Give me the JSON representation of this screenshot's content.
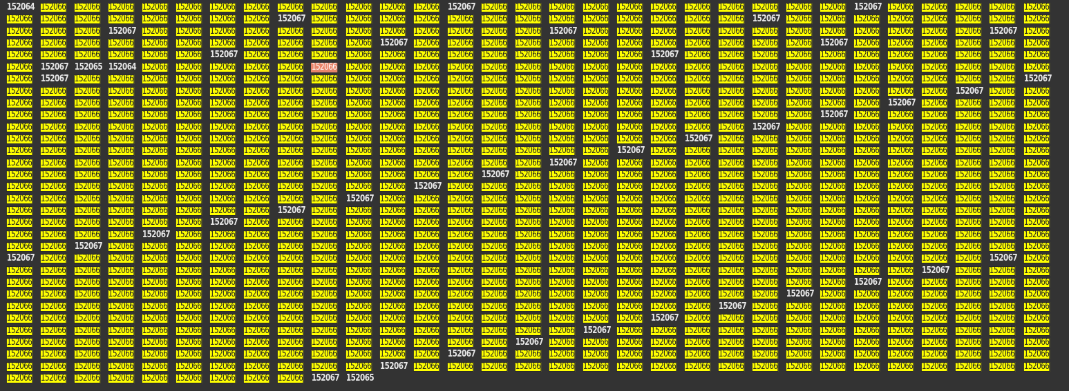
{
  "matches": {
    "match_value": "152066",
    "cursor_value": "152066",
    "colors": {
      "background": "#333333",
      "highlight": "#ffff00",
      "highlight_text": "#222222",
      "plain_text": "#e8e8e8",
      "current_match": "#e8856a"
    },
    "rows": [
      [
        "152064",
        "152066",
        "152066",
        "152066",
        "152066",
        "152066",
        "152066",
        "152066",
        "152066",
        "152066",
        "152066",
        "152066",
        "152066",
        "152067",
        "152066",
        "152066",
        "152066",
        "152066",
        "152066",
        "152066",
        "152066",
        "152066",
        "152066",
        "152066",
        "152066",
        "152067",
        "152066",
        "152066",
        "152066",
        "152066",
        "152066"
      ],
      [
        "152066",
        "152066",
        "152066",
        "152066",
        "152066",
        "152066",
        "152066",
        "152066",
        "152067",
        "152066",
        "152066",
        "152066",
        "152066",
        "152066",
        "152066",
        "152066",
        "152066",
        "152066",
        "152066",
        "152066",
        "152066",
        "152066",
        "152067",
        "152066",
        "152066",
        "152066",
        "152066",
        "152066",
        "152066",
        "152066",
        "152066"
      ],
      [
        "152066",
        "152066",
        "152066",
        "152067",
        "152066",
        "152066",
        "152066",
        "152066",
        "152066",
        "152066",
        "152066",
        "152066",
        "152066",
        "152066",
        "152066",
        "152066",
        "152067",
        "152066",
        "152066",
        "152066",
        "152066",
        "152066",
        "152066",
        "152066",
        "152066",
        "152066",
        "152066",
        "152066",
        "152066",
        "152067",
        "152066"
      ],
      [
        "152066",
        "152066",
        "152066",
        "152066",
        "152066",
        "152066",
        "152066",
        "152066",
        "152066",
        "152066",
        "152066",
        "152067",
        "152066",
        "152066",
        "152066",
        "152066",
        "152066",
        "152066",
        "152066",
        "152066",
        "152066",
        "152066",
        "152066",
        "152066",
        "152067",
        "152066",
        "152066",
        "152066",
        "152066",
        "152066",
        "152066"
      ],
      [
        "152066",
        "152066",
        "152066",
        "152066",
        "152066",
        "152066",
        "152067",
        "152066",
        "152066",
        "152066",
        "152066",
        "152066",
        "152066",
        "152066",
        "152066",
        "152066",
        "152066",
        "152066",
        "152066",
        "152067",
        "152066",
        "152066",
        "152066",
        "152066",
        "152066",
        "152066",
        "152066",
        "152066",
        "152066",
        "152066",
        "152066"
      ],
      [
        "152066",
        "152067",
        "152065",
        "152064",
        "152066",
        "152066",
        "152066",
        "152066",
        "152066",
        "152066",
        "152066",
        "152066",
        "152066",
        "152066",
        "152066",
        "152066",
        "152066",
        "152066",
        "152066",
        "152066",
        "152066",
        "152066",
        "152066",
        "152066",
        "152066",
        "152066",
        "152066",
        "152066",
        "152066",
        "152066",
        "152066"
      ],
      [
        "152066",
        "152067",
        "152066",
        "152066",
        "152066",
        "152066",
        "152066",
        "152066",
        "152066",
        "152066",
        "152066",
        "152066",
        "152066",
        "152066",
        "152066",
        "152066",
        "152066",
        "152066",
        "152066",
        "152066",
        "152066",
        "152066",
        "152066",
        "152066",
        "152066",
        "152066",
        "152066",
        "152066",
        "152066",
        "152066",
        "152067"
      ],
      [
        "152066",
        "152066",
        "152066",
        "152066",
        "152066",
        "152066",
        "152066",
        "152066",
        "152066",
        "152066",
        "152066",
        "152066",
        "152066",
        "152066",
        "152066",
        "152066",
        "152066",
        "152066",
        "152066",
        "152066",
        "152066",
        "152066",
        "152066",
        "152066",
        "152066",
        "152066",
        "152066",
        "152066",
        "152067",
        "152066",
        "152066"
      ],
      [
        "152066",
        "152066",
        "152066",
        "152066",
        "152066",
        "152066",
        "152066",
        "152066",
        "152066",
        "152066",
        "152066",
        "152066",
        "152066",
        "152066",
        "152066",
        "152066",
        "152066",
        "152066",
        "152066",
        "152066",
        "152066",
        "152066",
        "152066",
        "152066",
        "152066",
        "152066",
        "152067",
        "152066",
        "152066",
        "152066",
        "152066"
      ],
      [
        "152066",
        "152066",
        "152066",
        "152066",
        "152066",
        "152066",
        "152066",
        "152066",
        "152066",
        "152066",
        "152066",
        "152066",
        "152066",
        "152066",
        "152066",
        "152066",
        "152066",
        "152066",
        "152066",
        "152066",
        "152066",
        "152066",
        "152066",
        "152066",
        "152067",
        "152066",
        "152066",
        "152066",
        "152066",
        "152066",
        "152066"
      ],
      [
        "152066",
        "152066",
        "152066",
        "152066",
        "152066",
        "152066",
        "152066",
        "152066",
        "152066",
        "152066",
        "152066",
        "152066",
        "152066",
        "152066",
        "152066",
        "152066",
        "152066",
        "152066",
        "152066",
        "152066",
        "152066",
        "152066",
        "152067",
        "152066",
        "152066",
        "152066",
        "152066",
        "152066",
        "152066",
        "152066",
        "152066"
      ],
      [
        "152066",
        "152066",
        "152066",
        "152066",
        "152066",
        "152066",
        "152066",
        "152066",
        "152066",
        "152066",
        "152066",
        "152066",
        "152066",
        "152066",
        "152066",
        "152066",
        "152066",
        "152066",
        "152066",
        "152066",
        "152067",
        "152066",
        "152066",
        "152066",
        "152066",
        "152066",
        "152066",
        "152066",
        "152066",
        "152066",
        "152066"
      ],
      [
        "152066",
        "152066",
        "152066",
        "152066",
        "152066",
        "152066",
        "152066",
        "152066",
        "152066",
        "152066",
        "152066",
        "152066",
        "152066",
        "152066",
        "152066",
        "152066",
        "152066",
        "152066",
        "152067",
        "152066",
        "152066",
        "152066",
        "152066",
        "152066",
        "152066",
        "152066",
        "152066",
        "152066",
        "152066",
        "152066",
        "152066"
      ],
      [
        "152066",
        "152066",
        "152066",
        "152066",
        "152066",
        "152066",
        "152066",
        "152066",
        "152066",
        "152066",
        "152066",
        "152066",
        "152066",
        "152066",
        "152066",
        "152066",
        "152067",
        "152066",
        "152066",
        "152066",
        "152066",
        "152066",
        "152066",
        "152066",
        "152066",
        "152066",
        "152066",
        "152066",
        "152066",
        "152066",
        "152066"
      ],
      [
        "152066",
        "152066",
        "152066",
        "152066",
        "152066",
        "152066",
        "152066",
        "152066",
        "152066",
        "152066",
        "152066",
        "152066",
        "152066",
        "152066",
        "152067",
        "152066",
        "152066",
        "152066",
        "152066",
        "152066",
        "152066",
        "152066",
        "152066",
        "152066",
        "152066",
        "152066",
        "152066",
        "152066",
        "152066",
        "152066",
        "152066"
      ],
      [
        "152066",
        "152066",
        "152066",
        "152066",
        "152066",
        "152066",
        "152066",
        "152066",
        "152066",
        "152066",
        "152066",
        "152066",
        "152067",
        "152066",
        "152066",
        "152066",
        "152066",
        "152066",
        "152066",
        "152066",
        "152066",
        "152066",
        "152066",
        "152066",
        "152066",
        "152066",
        "152066",
        "152066",
        "152066",
        "152066",
        "152066"
      ],
      [
        "152066",
        "152066",
        "152066",
        "152066",
        "152066",
        "152066",
        "152066",
        "152066",
        "152066",
        "152066",
        "152067",
        "152066",
        "152066",
        "152066",
        "152066",
        "152066",
        "152066",
        "152066",
        "152066",
        "152066",
        "152066",
        "152066",
        "152066",
        "152066",
        "152066",
        "152066",
        "152066",
        "152066",
        "152066",
        "152066",
        "152066"
      ],
      [
        "152066",
        "152066",
        "152066",
        "152066",
        "152066",
        "152066",
        "152066",
        "152066",
        "152067",
        "152066",
        "152066",
        "152066",
        "152066",
        "152066",
        "152066",
        "152066",
        "152066",
        "152066",
        "152066",
        "152066",
        "152066",
        "152066",
        "152066",
        "152066",
        "152066",
        "152066",
        "152066",
        "152066",
        "152066",
        "152066",
        "152066"
      ],
      [
        "152066",
        "152066",
        "152066",
        "152066",
        "152066",
        "152066",
        "152067",
        "152066",
        "152066",
        "152066",
        "152066",
        "152066",
        "152066",
        "152066",
        "152066",
        "152066",
        "152066",
        "152066",
        "152066",
        "152066",
        "152066",
        "152066",
        "152066",
        "152066",
        "152066",
        "152066",
        "152066",
        "152066",
        "152066",
        "152066",
        "152066"
      ],
      [
        "152066",
        "152066",
        "152066",
        "152066",
        "152067",
        "152066",
        "152066",
        "152066",
        "152066",
        "152066",
        "152066",
        "152066",
        "152066",
        "152066",
        "152066",
        "152066",
        "152066",
        "152066",
        "152066",
        "152066",
        "152066",
        "152066",
        "152066",
        "152066",
        "152066",
        "152066",
        "152066",
        "152066",
        "152066",
        "152066",
        "152066"
      ],
      [
        "152066",
        "152066",
        "152067",
        "152066",
        "152066",
        "152066",
        "152066",
        "152066",
        "152066",
        "152066",
        "152066",
        "152066",
        "152066",
        "152066",
        "152066",
        "152066",
        "152066",
        "152066",
        "152066",
        "152066",
        "152066",
        "152066",
        "152066",
        "152066",
        "152066",
        "152066",
        "152066",
        "152066",
        "152066",
        "152066",
        "152066"
      ],
      [
        "152067",
        "152066",
        "152066",
        "152066",
        "152066",
        "152066",
        "152066",
        "152066",
        "152066",
        "152066",
        "152066",
        "152066",
        "152066",
        "152066",
        "152066",
        "152066",
        "152066",
        "152066",
        "152066",
        "152066",
        "152066",
        "152066",
        "152066",
        "152066",
        "152066",
        "152066",
        "152066",
        "152066",
        "152066",
        "152067",
        "152066"
      ],
      [
        "152066",
        "152066",
        "152066",
        "152066",
        "152066",
        "152066",
        "152066",
        "152066",
        "152066",
        "152066",
        "152066",
        "152066",
        "152066",
        "152066",
        "152066",
        "152066",
        "152066",
        "152066",
        "152066",
        "152066",
        "152066",
        "152066",
        "152066",
        "152066",
        "152066",
        "152066",
        "152066",
        "152067",
        "152066",
        "152066",
        "152066"
      ],
      [
        "152066",
        "152066",
        "152066",
        "152066",
        "152066",
        "152066",
        "152066",
        "152066",
        "152066",
        "152066",
        "152066",
        "152066",
        "152066",
        "152066",
        "152066",
        "152066",
        "152066",
        "152066",
        "152066",
        "152066",
        "152066",
        "152066",
        "152066",
        "152066",
        "152066",
        "152067",
        "152066",
        "152066",
        "152066",
        "152066",
        "152066"
      ],
      [
        "152066",
        "152066",
        "152066",
        "152066",
        "152066",
        "152066",
        "152066",
        "152066",
        "152066",
        "152066",
        "152066",
        "152066",
        "152066",
        "152066",
        "152066",
        "152066",
        "152066",
        "152066",
        "152066",
        "152066",
        "152066",
        "152066",
        "152066",
        "152067",
        "152066",
        "152066",
        "152066",
        "152066",
        "152066",
        "152066",
        "152066"
      ],
      [
        "152066",
        "152066",
        "152066",
        "152066",
        "152066",
        "152066",
        "152066",
        "152066",
        "152066",
        "152066",
        "152066",
        "152066",
        "152066",
        "152066",
        "152066",
        "152066",
        "152066",
        "152066",
        "152066",
        "152066",
        "152066",
        "152067",
        "152066",
        "152066",
        "152066",
        "152066",
        "152066",
        "152066",
        "152066",
        "152066",
        "152066"
      ],
      [
        "152066",
        "152066",
        "152066",
        "152066",
        "152066",
        "152066",
        "152066",
        "152066",
        "152066",
        "152066",
        "152066",
        "152066",
        "152066",
        "152066",
        "152066",
        "152066",
        "152066",
        "152066",
        "152066",
        "152067",
        "152066",
        "152066",
        "152066",
        "152066",
        "152066",
        "152066",
        "152066",
        "152066",
        "152066",
        "152066",
        "152066"
      ],
      [
        "152066",
        "152066",
        "152066",
        "152066",
        "152066",
        "152066",
        "152066",
        "152066",
        "152066",
        "152066",
        "152066",
        "152066",
        "152066",
        "152066",
        "152066",
        "152066",
        "152066",
        "152067",
        "152066",
        "152066",
        "152066",
        "152066",
        "152066",
        "152066",
        "152066",
        "152066",
        "152066",
        "152066",
        "152066",
        "152066",
        "152066"
      ],
      [
        "152066",
        "152066",
        "152066",
        "152066",
        "152066",
        "152066",
        "152066",
        "152066",
        "152066",
        "152066",
        "152066",
        "152066",
        "152066",
        "152066",
        "152066",
        "152067",
        "152066",
        "152066",
        "152066",
        "152066",
        "152066",
        "152066",
        "152066",
        "152066",
        "152066",
        "152066",
        "152066",
        "152066",
        "152066",
        "152066",
        "152066"
      ],
      [
        "152066",
        "152066",
        "152066",
        "152066",
        "152066",
        "152066",
        "152066",
        "152066",
        "152066",
        "152066",
        "152066",
        "152066",
        "152066",
        "152067",
        "152066",
        "152066",
        "152066",
        "152066",
        "152066",
        "152066",
        "152066",
        "152066",
        "152066",
        "152066",
        "152066",
        "152066",
        "152066",
        "152066",
        "152066",
        "152066",
        "152066"
      ],
      [
        "152066",
        "152066",
        "152066",
        "152066",
        "152066",
        "152066",
        "152066",
        "152066",
        "152066",
        "152066",
        "152066",
        "152067",
        "152066",
        "152066",
        "152066",
        "152066",
        "152066",
        "152066",
        "152066",
        "152066",
        "152066",
        "152066",
        "152066",
        "152066",
        "152066",
        "152066",
        "152066",
        "152066",
        "152066",
        "152066",
        "152066"
      ],
      [
        "152066",
        "152066",
        "152066",
        "152066",
        "152066",
        "152066",
        "152066",
        "152066",
        "152066",
        "152067",
        "152065"
      ]
    ],
    "current_match": {
      "row": 5,
      "col": 9
    }
  }
}
